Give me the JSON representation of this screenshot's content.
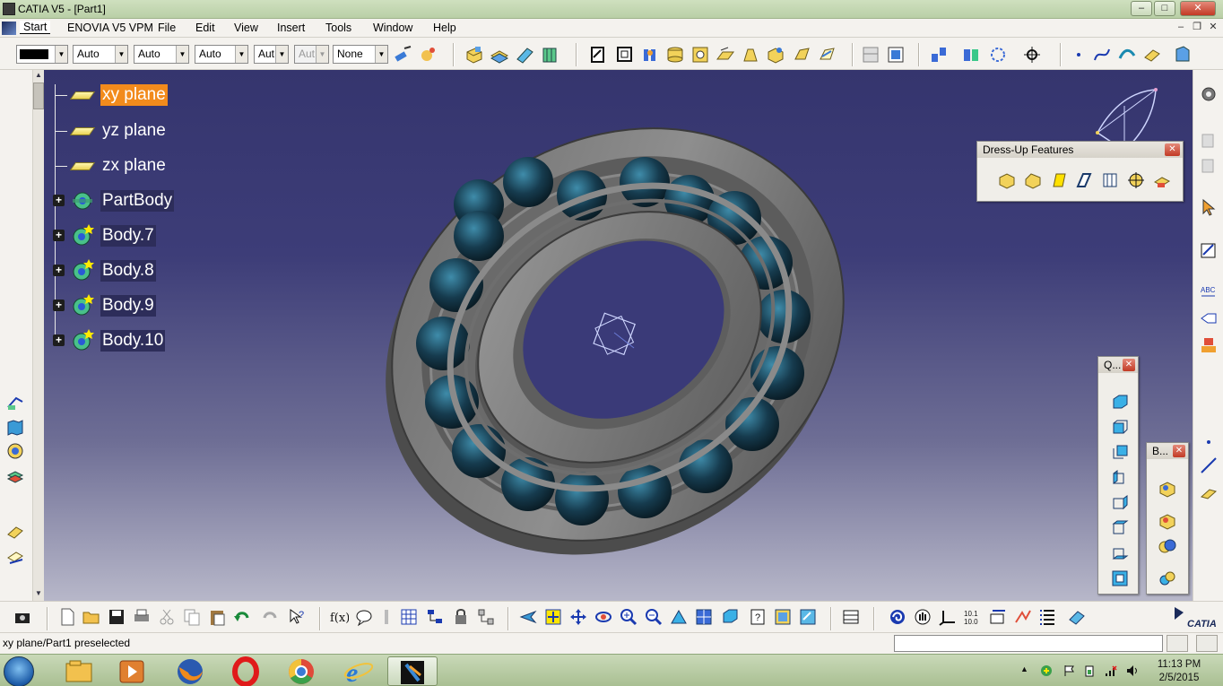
{
  "window": {
    "title": "CATIA V5 - [Part1]",
    "controls": {
      "minimize": "–",
      "maximize": "□",
      "close": "✕"
    }
  },
  "menubar": {
    "items": [
      {
        "label": "Start"
      },
      {
        "label": "ENOVIA V5 VPM"
      },
      {
        "label": "File"
      },
      {
        "label": "Edit"
      },
      {
        "label": "View"
      },
      {
        "label": "Insert"
      },
      {
        "label": "Tools"
      },
      {
        "label": "Window"
      },
      {
        "label": "Help"
      }
    ],
    "doc_controls": {
      "minimize": "–",
      "restore": "❐",
      "close": "✕"
    }
  },
  "graphic_properties": {
    "color": "",
    "transparency": "Auto",
    "line_thickness": "Auto",
    "line_type": "Auto",
    "point_type": "Aut",
    "layer_disabled": "Aut",
    "layer": "None"
  },
  "spec_tree": {
    "nodes": [
      {
        "label": "xy plane",
        "type": "plane",
        "selected": true
      },
      {
        "label": "yz plane",
        "type": "plane",
        "selected": false
      },
      {
        "label": "zx plane",
        "type": "plane",
        "selected": false
      },
      {
        "label": "PartBody",
        "type": "body",
        "expandable": true
      },
      {
        "label": "Body.7",
        "type": "body-new",
        "expandable": true
      },
      {
        "label": "Body.8",
        "type": "body-new",
        "expandable": true
      },
      {
        "label": "Body.9",
        "type": "body-new",
        "expandable": true
      },
      {
        "label": "Body.10",
        "type": "body-new",
        "expandable": true
      }
    ]
  },
  "palettes": {
    "dressup": {
      "title": "Dress-Up Features",
      "icons": [
        "fillet-icon",
        "chamfer-icon",
        "draft-icon",
        "shell-icon",
        "thickness-icon",
        "thread-icon",
        "remove-face-icon"
      ]
    },
    "q": {
      "title": "Q...",
      "icons": [
        "iso-view-icon",
        "front-view-icon",
        "back-view-icon",
        "left-view-icon",
        "right-view-icon",
        "top-view-icon",
        "bottom-view-icon",
        "named-views-icon"
      ]
    },
    "b": {
      "title": "B...",
      "icons": [
        "assemble-icon",
        "add-body-icon",
        "remove-body-icon",
        "intersect-icon"
      ]
    }
  },
  "status": {
    "message": "xy plane/Part1 preselected",
    "command_input": ""
  },
  "taskbar": {
    "apps": [
      "explorer",
      "media-player",
      "firefox",
      "opera",
      "chrome",
      "internet-explorer",
      "catia"
    ],
    "clock": {
      "time": "11:13 PM",
      "date": "2/5/2015"
    }
  },
  "colors": {
    "selection": "#f28b1c",
    "viewport_top": "#35356e",
    "viewport_bottom": "#b7b7c9",
    "chrome": "#f4f2ee",
    "titlebar": "#c4d6b2"
  }
}
